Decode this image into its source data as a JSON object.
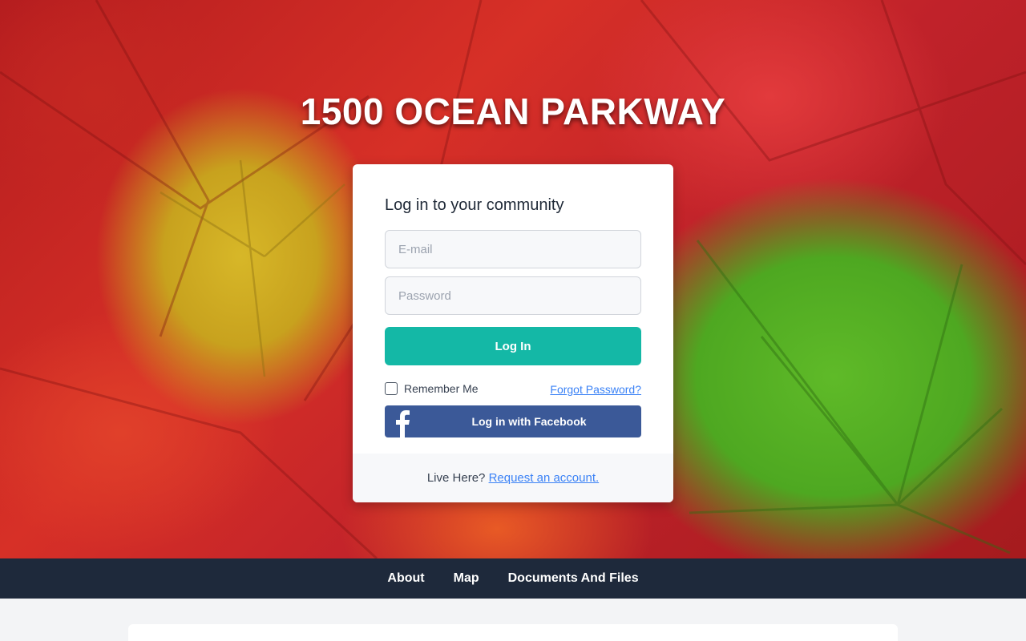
{
  "site": {
    "title": "1500 OCEAN PARKWAY"
  },
  "login": {
    "heading": "Log in to your community",
    "email_placeholder": "E-mail",
    "password_placeholder": "Password",
    "login_label": "Log In",
    "remember_label": "Remember Me",
    "forgot_label": "Forgot Password?",
    "facebook_label": "Log in with Facebook",
    "footer_text": "Live Here?",
    "request_label": "Request an account."
  },
  "nav": {
    "items": [
      {
        "label": "About"
      },
      {
        "label": "Map"
      },
      {
        "label": "Documents And Files"
      }
    ]
  },
  "colors": {
    "accent": "#14b8a6",
    "facebook": "#3b5998",
    "navbar": "#1e293b",
    "link": "#3b82f6"
  },
  "icons": {
    "facebook": "facebook-f-icon",
    "checkbox": "checkbox-unchecked"
  }
}
